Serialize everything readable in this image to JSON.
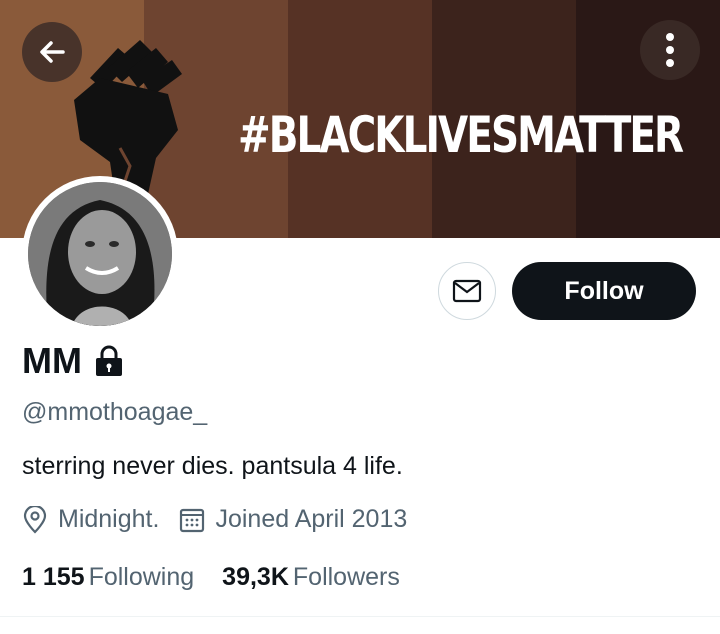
{
  "banner": {
    "hashtag": "#BLACKLIVESMATTER",
    "stripe_colors": [
      "#8a5a3a",
      "#6e4430",
      "#563225",
      "#3c231c",
      "#2a1816"
    ]
  },
  "header": {
    "back_icon": "arrow-left-icon",
    "more_icon": "more-vertical-icon"
  },
  "profile": {
    "name": "MM",
    "protected_icon": "lock-icon",
    "handle": "@mmothoagae_",
    "bio": "sterring never dies. pantsula 4 life.",
    "location": "Midnight.",
    "joined": "Joined April 2013",
    "following_count": "1 155",
    "following_label": "Following",
    "followers_count": "39,3K",
    "followers_label": "Followers"
  },
  "actions": {
    "message_icon": "envelope-icon",
    "follow_label": "Follow"
  }
}
